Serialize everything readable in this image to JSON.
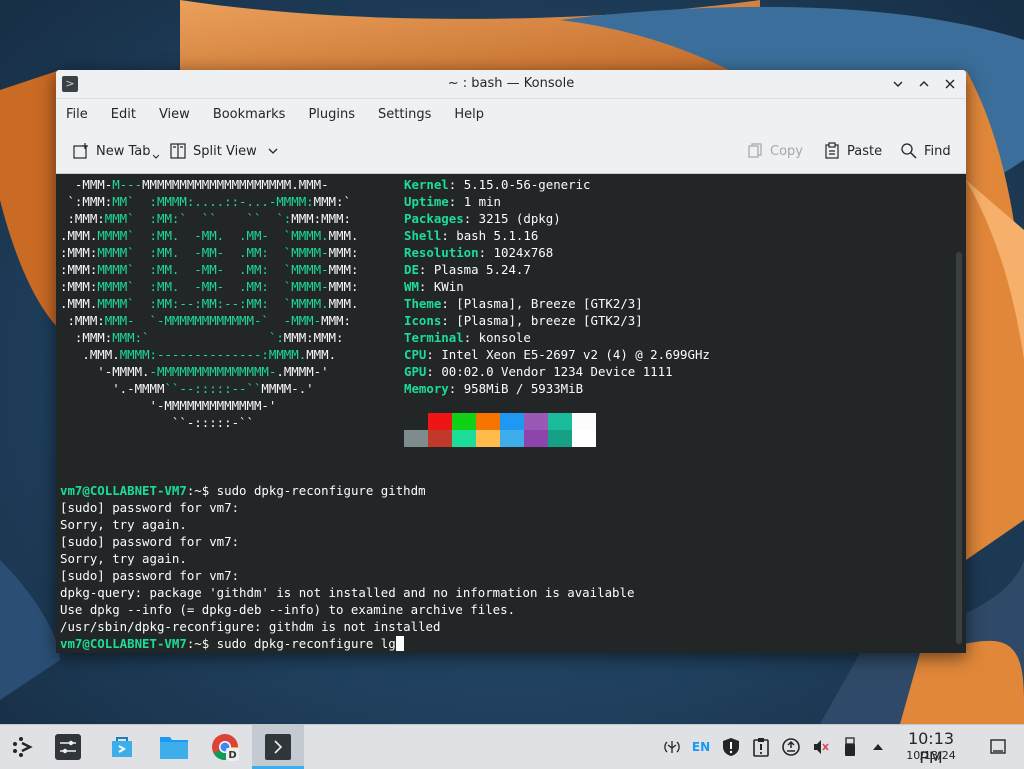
{
  "window": {
    "title": "~ : bash — Konsole"
  },
  "menu": [
    "File",
    "Edit",
    "View",
    "Bookmarks",
    "Plugins",
    "Settings",
    "Help"
  ],
  "toolbar": {
    "new_tab": "New Tab",
    "split_view": "Split View",
    "copy": "Copy",
    "paste": "Paste",
    "find": "Find"
  },
  "neofetch": {
    "logo": [
      [
        [
          "w",
          "  -MMM-"
        ],
        [
          "g",
          "M---"
        ],
        [
          "w",
          "MMMMMMMMMMMMMMMMMMMM.MMM-"
        ]
      ],
      [
        [
          "w",
          " `:MMM:"
        ],
        [
          "g",
          "MM`  :MMMM:....::-...-MMMM:"
        ],
        [
          "w",
          "MMM:`"
        ]
      ],
      [
        [
          "w",
          " :MMM:"
        ],
        [
          "g",
          "MMM`  :MM:`  ``    ``  `:"
        ],
        [
          "w",
          "MMM:MMM:"
        ]
      ],
      [
        [
          "w",
          ".MMM."
        ],
        [
          "g",
          "MMMM`  :MM.  -MM.  .MM-  `MMMM."
        ],
        [
          "w",
          "MMM."
        ]
      ],
      [
        [
          "w",
          ":MMM:"
        ],
        [
          "g",
          "MMMM`  :MM.  -MM-  .MM:  `MMMM-"
        ],
        [
          "w",
          "MMM:"
        ]
      ],
      [
        [
          "w",
          ":MMM:"
        ],
        [
          "g",
          "MMMM`  :MM.  -MM-  .MM:  `MMMM-"
        ],
        [
          "w",
          "MMM:"
        ]
      ],
      [
        [
          "w",
          ":MMM:"
        ],
        [
          "g",
          "MMMM`  :MM.  -MM-  .MM:  `MMMM-"
        ],
        [
          "w",
          "MMM:"
        ]
      ],
      [
        [
          "w",
          ".MMM."
        ],
        [
          "g",
          "MMMM`  :MM:--:MM:--:MM:  `MMMM."
        ],
        [
          "w",
          "MMM."
        ]
      ],
      [
        [
          "w",
          " :MMM:"
        ],
        [
          "g",
          "MMM-  `-MMMMMMMMMMMM-`  -MMM-"
        ],
        [
          "w",
          "MMM:"
        ]
      ],
      [
        [
          "w",
          "  :MMM:"
        ],
        [
          "g",
          "MMM:`                `:"
        ],
        [
          "w",
          "MMM:MMM:"
        ]
      ],
      [
        [
          "w",
          "   .MMM."
        ],
        [
          "g",
          "MMMM:--------------:MMMM."
        ],
        [
          "w",
          "MMM."
        ]
      ],
      [
        [
          "w",
          "     '-MMMM."
        ],
        [
          "g",
          "-MMMMMMMMMMMMMMM-"
        ],
        [
          "w",
          ".MMMM-'"
        ]
      ],
      [
        [
          "w",
          "       '.-MMMM"
        ],
        [
          "g",
          "``--:::::--``"
        ],
        [
          "w",
          "MMMM-.'"
        ]
      ],
      [
        [
          "w",
          "            '-MMMMMMMMMMMMM-'"
        ]
      ],
      [
        [
          "w",
          "               ``-:::::-``"
        ]
      ]
    ],
    "info": [
      {
        "key": "Kernel",
        "value": "5.15.0-56-generic"
      },
      {
        "key": "Uptime",
        "value": "1 min"
      },
      {
        "key": "Packages",
        "value": "3215 (dpkg)"
      },
      {
        "key": "Shell",
        "value": "bash 5.1.16"
      },
      {
        "key": "Resolution",
        "value": "1024x768"
      },
      {
        "key": "DE",
        "value": "Plasma 5.24.7"
      },
      {
        "key": "WM",
        "value": "KWin"
      },
      {
        "key": "Theme",
        "value": "[Plasma], Breeze [GTK2/3]"
      },
      {
        "key": "Icons",
        "value": "[Plasma], breeze [GTK2/3]"
      },
      {
        "key": "Terminal",
        "value": "konsole"
      },
      {
        "key": "CPU",
        "value": "Intel Xeon E5-2697 v2 (4) @ 2.699GHz"
      },
      {
        "key": "GPU",
        "value": "00:02.0 Vendor 1234 Device 1111"
      },
      {
        "key": "Memory",
        "value": "958MiB / 5933MiB"
      }
    ],
    "palette_top": [
      "#232627",
      "#ed1515",
      "#11d116",
      "#f67400",
      "#1d99f3",
      "#9b59b6",
      "#1abc9c",
      "#fcfcfc"
    ],
    "palette_bottom": [
      "#7f8c8d",
      "#c0392b",
      "#1cdc9a",
      "#fdbc4b",
      "#3daee9",
      "#8e44ad",
      "#16a085",
      "#ffffff"
    ]
  },
  "session": {
    "prompt_user": "vm7@COLLABNET-VM7",
    "prompt_suffix": ":~$ ",
    "command1": "sudo dpkg-reconfigure githdm",
    "output": [
      "[sudo] password for vm7:",
      "Sorry, try again.",
      "[sudo] password for vm7:",
      "Sorry, try again.",
      "[sudo] password for vm7:",
      "dpkg-query: package 'githdm' is not installed and no information is available",
      "Use dpkg --info (= dpkg-deb --info) to examine archive files.",
      "/usr/sbin/dpkg-reconfigure: githdm is not installed"
    ],
    "command2": "sudo dpkg-reconfigure lg"
  },
  "taskbar": {
    "language": "EN",
    "time": "10:13 PM",
    "date": "10/13/24"
  },
  "colors": {
    "accent": "#3daee9",
    "terminal_bg": "#232627",
    "neofetch_green": "#1cdc9a"
  }
}
